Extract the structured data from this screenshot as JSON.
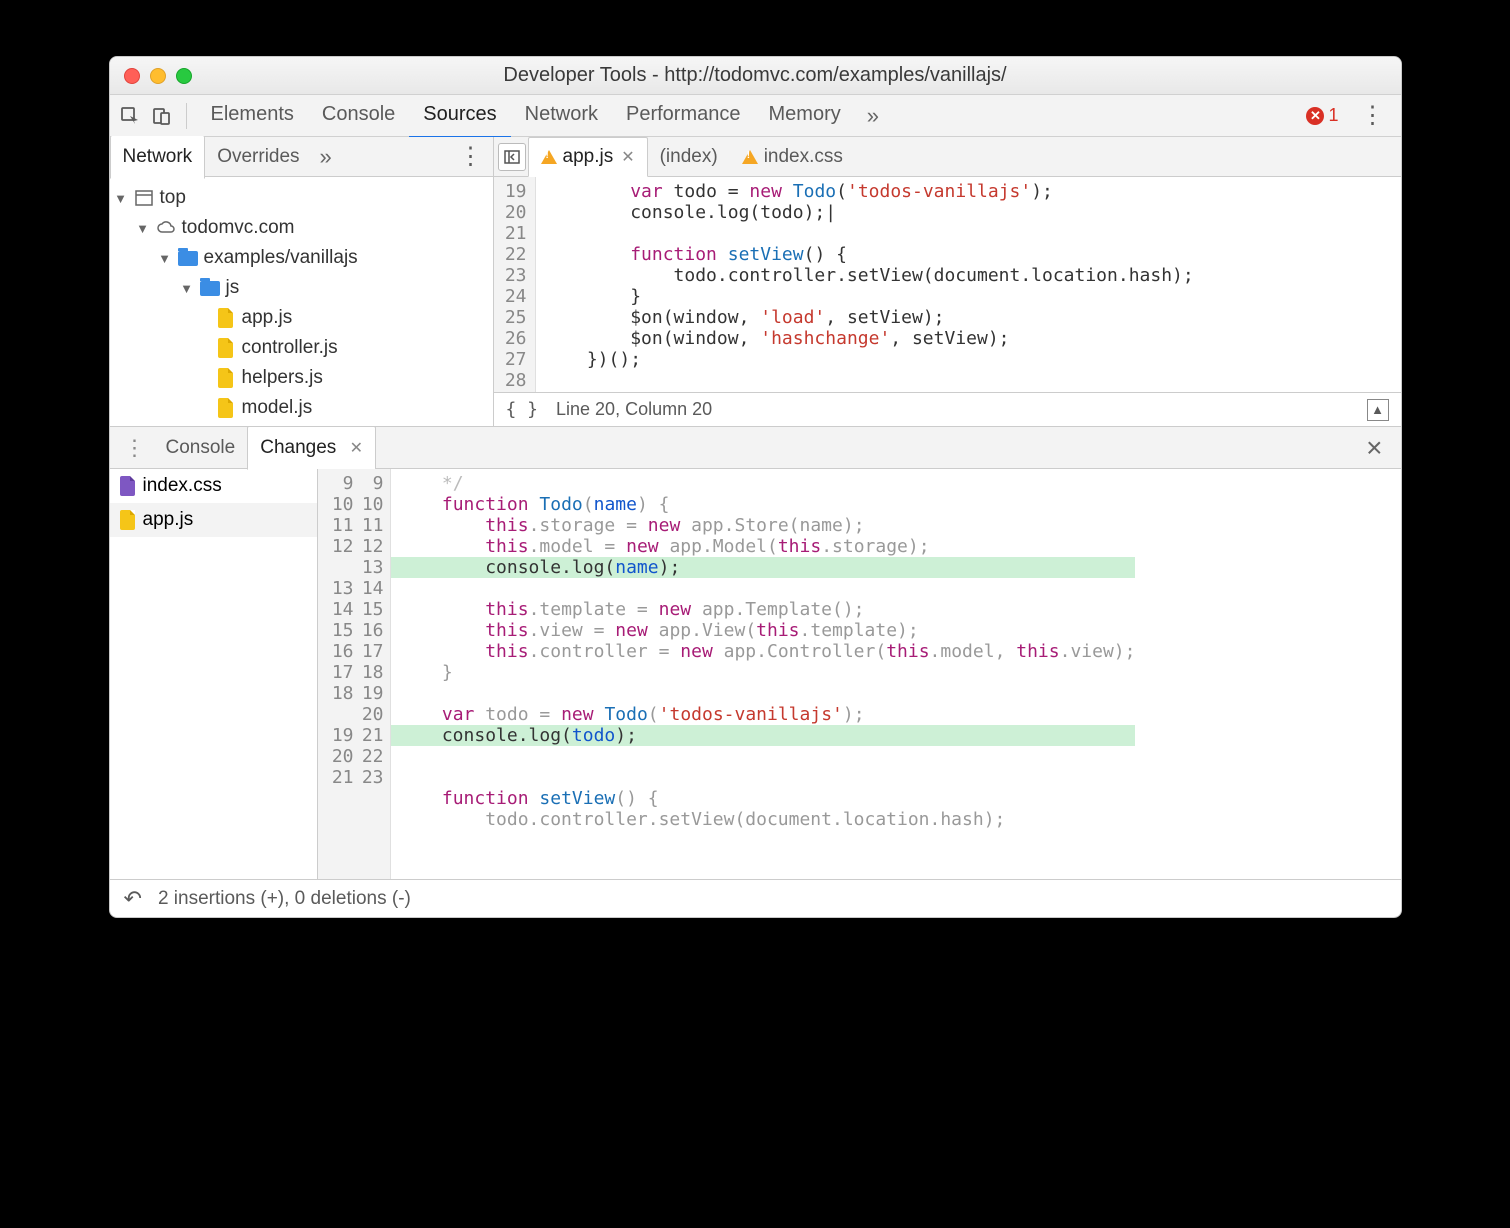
{
  "window": {
    "title": "Developer Tools - http://todomvc.com/examples/vanillajs/"
  },
  "mainTabs": {
    "items": [
      "Elements",
      "Console",
      "Sources",
      "Network",
      "Performance",
      "Memory"
    ],
    "activeIndex": 2,
    "more": "»",
    "errorCount": "1"
  },
  "navPanel": {
    "tabs": [
      "Network",
      "Overrides"
    ],
    "activeIndex": 0,
    "more": "»",
    "tree": {
      "top": "top",
      "domain": "todomvc.com",
      "path": "examples/vanillajs",
      "folder": "js",
      "files": [
        "app.js",
        "controller.js",
        "helpers.js",
        "model.js"
      ]
    }
  },
  "editor": {
    "tabs": [
      {
        "label": "app.js",
        "warn": true,
        "closeable": true,
        "active": true
      },
      {
        "label": "(index)",
        "warn": false,
        "closeable": false,
        "active": false
      },
      {
        "label": "index.css",
        "warn": true,
        "closeable": false,
        "active": false
      }
    ],
    "gutterStart": 19,
    "codeLines": [
      {
        "n": 19,
        "html": "        <span class='kw'>var</span> todo = <span class='kw'>new</span> <span class='fn'>Todo</span>(<span class='str'>'todos-vanillajs'</span>);"
      },
      {
        "n": 20,
        "html": "        console.log(todo);|"
      },
      {
        "n": 21,
        "html": ""
      },
      {
        "n": 22,
        "html": "        <span class='kw'>function</span> <span class='fn'>setView</span>() {"
      },
      {
        "n": 23,
        "html": "            todo.controller.setView(document.location.hash);"
      },
      {
        "n": 24,
        "html": "        }"
      },
      {
        "n": 25,
        "html": "        $on(window, <span class='str'>'load'</span>, setView);"
      },
      {
        "n": 26,
        "html": "        $on(window, <span class='str'>'hashchange'</span>, setView);"
      },
      {
        "n": 27,
        "html": "    })();"
      },
      {
        "n": 28,
        "html": ""
      }
    ],
    "status": "Line 20, Column 20",
    "prettyPrint": "{ }"
  },
  "drawer": {
    "tabs": [
      "Console",
      "Changes"
    ],
    "activeIndex": 1,
    "sideFiles": [
      {
        "label": "index.css",
        "type": "css",
        "selected": false
      },
      {
        "label": "app.js",
        "type": "js",
        "selected": true
      }
    ],
    "diffLines": [
      {
        "l": "9",
        "r": "9",
        "added": false,
        "html": "    <span class='comment'>*/</span>"
      },
      {
        "l": "10",
        "r": "10",
        "added": false,
        "html": "    <span class='kw'>function</span> <span class='fn'>Todo</span>(<span class='var'>name</span>) {"
      },
      {
        "l": "11",
        "r": "11",
        "added": false,
        "html": "        <span class='kw'>this</span>.storage = <span class='kw'>new</span> app.Store(name);"
      },
      {
        "l": "12",
        "r": "12",
        "added": false,
        "html": "        <span class='kw'>this</span>.model = <span class='kw'>new</span> app.Model(<span class='kw'>this</span>.storage);"
      },
      {
        "l": "",
        "r": "13",
        "added": true,
        "html": "        console.log(<span class='var'>name</span>);"
      },
      {
        "l": "13",
        "r": "14",
        "added": false,
        "html": "        <span class='kw'>this</span>.template = <span class='kw'>new</span> app.Template();"
      },
      {
        "l": "14",
        "r": "15",
        "added": false,
        "html": "        <span class='kw'>this</span>.view = <span class='kw'>new</span> app.View(<span class='kw'>this</span>.template);"
      },
      {
        "l": "15",
        "r": "16",
        "added": false,
        "html": "        <span class='kw'>this</span>.controller = <span class='kw'>new</span> app.Controller(<span class='kw'>this</span>.model, <span class='kw'>this</span>.view);"
      },
      {
        "l": "16",
        "r": "17",
        "added": false,
        "html": "    }"
      },
      {
        "l": "17",
        "r": "18",
        "added": false,
        "html": ""
      },
      {
        "l": "18",
        "r": "19",
        "added": false,
        "html": "    <span class='kw'>var</span> todo = <span class='kw'>new</span> <span class='fn'>Todo</span>(<span class='str'>'todos-vanillajs'</span>);"
      },
      {
        "l": "",
        "r": "20",
        "added": true,
        "html": "    console.log(<span class='var'>todo</span>);"
      },
      {
        "l": "19",
        "r": "21",
        "added": false,
        "html": ""
      },
      {
        "l": "20",
        "r": "22",
        "added": false,
        "html": "    <span class='kw'>function</span> <span class='fn'>setView</span>() {"
      },
      {
        "l": "21",
        "r": "23",
        "added": false,
        "html": "        todo.controller.setView(document.location.hash);"
      }
    ],
    "status": "2 insertions (+), 0 deletions (-)"
  }
}
